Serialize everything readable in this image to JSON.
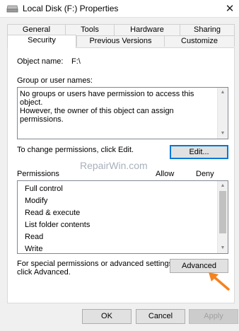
{
  "window": {
    "title": "Local Disk (F:) Properties",
    "close_glyph": "✕"
  },
  "tabs_back": [
    "General",
    "Tools",
    "Hardware",
    "Sharing"
  ],
  "tabs_front": [
    "Security",
    "Previous Versions",
    "Customize"
  ],
  "active_tab": "Security",
  "object_name_label": "Object name:",
  "object_name_value": "F:\\",
  "group_label": "Group or user names:",
  "group_message_line1": "No groups or users have permission to access this object.",
  "group_message_line2": "However, the owner of this object can assign permissions.",
  "change_permissions_text": "To change permissions, click Edit.",
  "edit_button": "Edit...",
  "watermark": "RepairWin.com",
  "permissions_header": {
    "label": "Permissions",
    "allow": "Allow",
    "deny": "Deny"
  },
  "permissions": [
    "Full control",
    "Modify",
    "Read & execute",
    "List folder contents",
    "Read",
    "Write"
  ],
  "special_text_line1": "For special permissions or advanced settings,",
  "special_text_line2": "click Advanced.",
  "advanced_button": "Advanced",
  "footer": {
    "ok": "OK",
    "cancel": "Cancel",
    "apply": "Apply"
  },
  "colors": {
    "focus_border": "#0078d7",
    "arrow": "#f5821f"
  }
}
